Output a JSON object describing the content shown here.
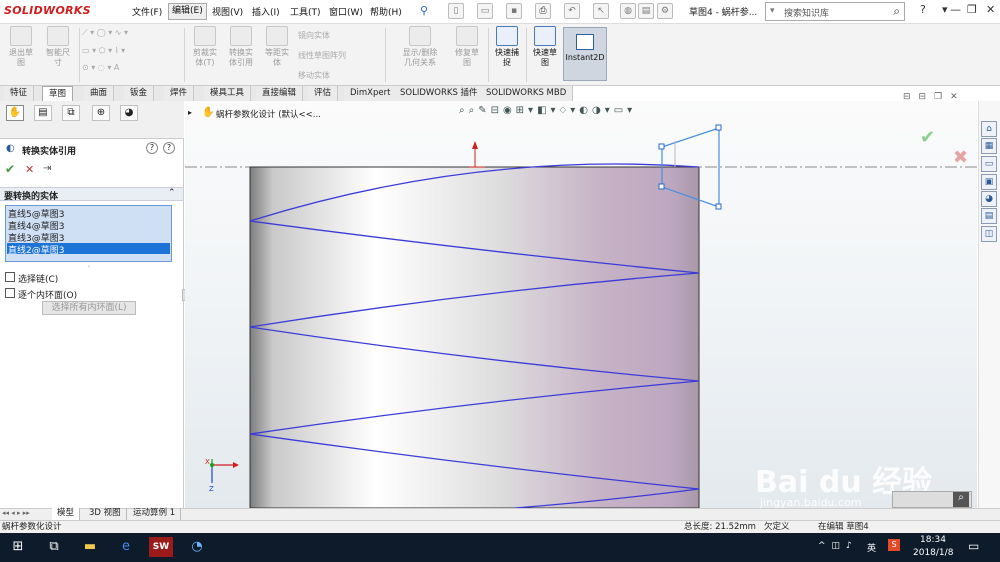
{
  "app": {
    "logo": "SOLIDWORKS",
    "document_title": "草图4 - 蜗杆参..."
  },
  "menu": [
    "文件(F)",
    "编辑(E)",
    "视图(V)",
    "插入(I)",
    "工具(T)",
    "窗口(W)",
    "帮助(H)"
  ],
  "search": {
    "placeholder": "搜索知识库"
  },
  "titlebar_icons": [
    "help-icon",
    "user-icon",
    "minimize-icon",
    "restore-icon",
    "close-icon"
  ],
  "ribbon": {
    "exit_sketch": "退出草\n图",
    "smart_dim": "智能尺\n寸",
    "mirror": "镜向实体",
    "linear_pattern": "线性草图阵列",
    "move": "移动实体",
    "trim": "剪裁实\n体(T)",
    "convert": "转换实\n体引用",
    "offset": "等距实\n体",
    "show_relations": "显示/删除\n几何关系",
    "repair": "修复草\n图",
    "quick_snap": "快速捕\n捉",
    "rapid_sketch": "快速草\n图",
    "instant2d": "Instant2D"
  },
  "tabs": [
    "特征",
    "草图",
    "曲面",
    "钣金",
    "焊件",
    "模具工具",
    "直接编辑",
    "评估",
    "DimXpert",
    "SOLIDWORKS 插件",
    "SOLIDWORKS MBD"
  ],
  "active_tab": "草图",
  "property_manager": {
    "title": "转换实体引用",
    "section": "要转换的实体",
    "entities": [
      "直线5@草图3",
      "直线4@草图3",
      "直线3@草图3",
      "直线2@草图3"
    ],
    "selected_index": 3,
    "select_chain": "选择链(C)",
    "inner_loops": "逐个内环面(O)",
    "select_all_loops": "选择所有内环面(L)"
  },
  "feature_tree": {
    "breadcrumb": "蜗杆参数化设计  (默认<<..."
  },
  "model_tabs": [
    "模型",
    "3D 视图",
    "运动算例 1"
  ],
  "status": {
    "left": "蜗杆参数化设计",
    "total_length": "总长度: 21.52mm",
    "right_partial": "欠定义",
    "editing": "在编辑 草图4"
  },
  "triad": {
    "x": "X",
    "y": "Y",
    "z": "Z"
  },
  "watermark": {
    "text": "Bai du 经验",
    "url": "jingyan.baidu.com"
  },
  "taskbar": {
    "time": "18:34",
    "date": "2018/1/8",
    "lang": "英"
  },
  "colors": {
    "helix": "#3b3bd9",
    "sketch_select": "#4a8fe0",
    "accept": "#3a9a3a",
    "cancel": "#cc3333",
    "ribbon_active": "#cfd6df"
  }
}
